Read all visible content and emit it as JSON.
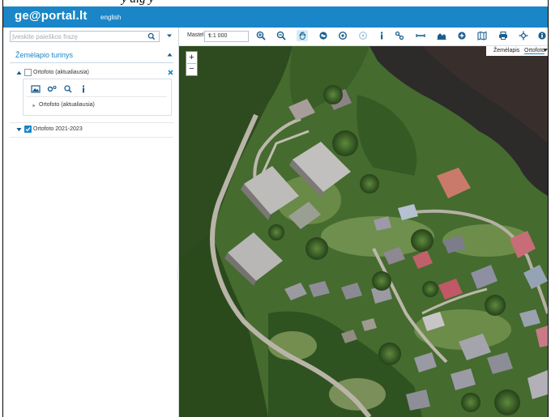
{
  "header": {
    "logo": "ge@portal.lt",
    "language_link": "english",
    "color": "#1a86c7"
  },
  "search": {
    "placeholder": "Įveskite paieškos frazę",
    "icon": "search-icon"
  },
  "layers": {
    "section_title": "Žemėlapio turinys",
    "items": [
      {
        "label": "Ortofoto (aktualiausia)",
        "checked": false,
        "expanded": true,
        "sublayers": [
          {
            "label": "Ortofoto (aktualiausia)"
          }
        ]
      },
      {
        "label": "Ortofoto 2021-2023",
        "checked": true,
        "expanded": false
      }
    ],
    "remove_icon": "close-icon"
  },
  "toolbar": {
    "scale_label": "Mastelis:",
    "scale_value": "1:1 000",
    "tools": [
      "zoom-in-icon",
      "zoom-out-icon",
      "pan-icon",
      "globe-icon",
      "zoom-target-icon",
      "locate-icon",
      "info-icon",
      "link-icon",
      "measure-icon",
      "profile-icon",
      "add-data-icon",
      "map-icon",
      "print-icon",
      "coordinates-icon",
      "about-icon"
    ]
  },
  "map": {
    "zoom_in": "+",
    "zoom_out": "−",
    "basemap_options": [
      "Žemėlapis",
      "Ortofoto"
    ]
  }
}
